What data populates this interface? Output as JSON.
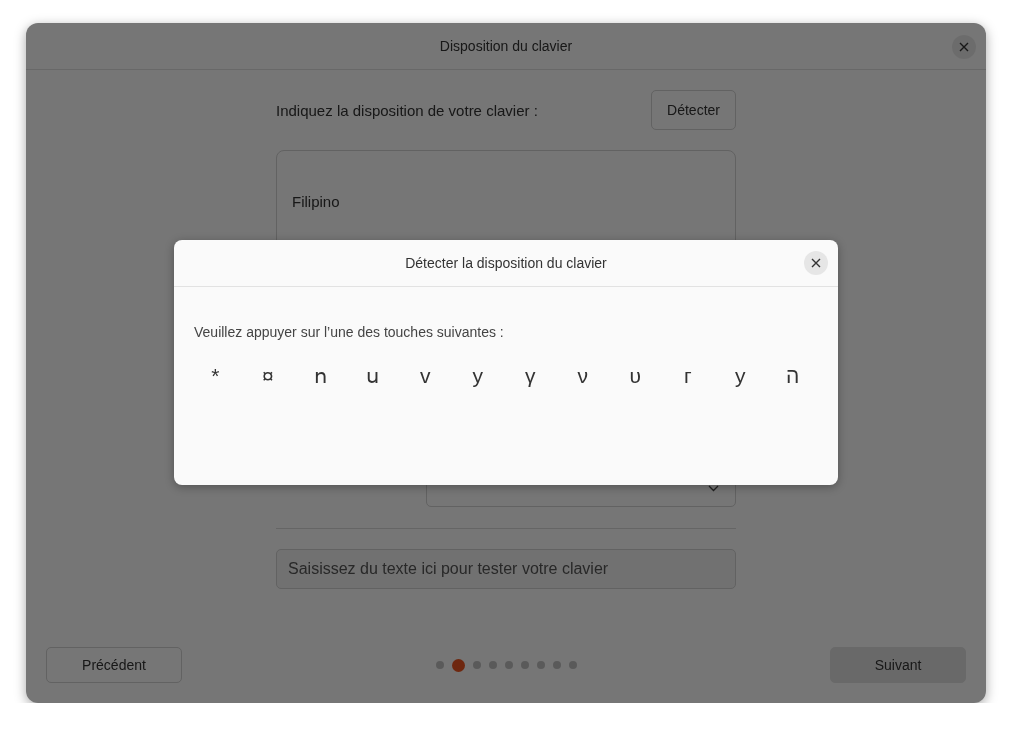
{
  "window": {
    "title": "Disposition du clavier"
  },
  "prompt": "Indiquez la disposition de votre clavier :",
  "detect_button": "Détecter",
  "layouts": [
    "Filipino"
  ],
  "variant": {
    "kind": "dropdown"
  },
  "test_field": {
    "placeholder": "Saisissez du texte ici pour tester votre clavier"
  },
  "footer": {
    "back": "Précédent",
    "next": "Suivant",
    "steps": [
      {
        "selected": false
      },
      {
        "selected": true
      },
      {
        "selected": false
      },
      {
        "selected": false
      },
      {
        "selected": false
      },
      {
        "selected": false
      },
      {
        "selected": false
      },
      {
        "selected": false
      },
      {
        "selected": false
      }
    ]
  },
  "dialog": {
    "title": "Détecter la disposition du clavier",
    "instruction": "Veuillez appuyer sur l’une des touches suivantes :",
    "keys": [
      "*",
      "¤",
      "ո",
      "ս",
      "v",
      "у",
      "γ",
      "ν",
      "υ",
      "г",
      "у",
      "ה"
    ]
  }
}
